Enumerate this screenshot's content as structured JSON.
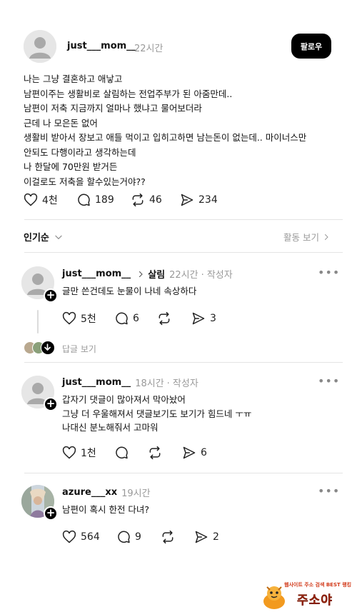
{
  "post": {
    "username": "just___mom__",
    "time": "22시간",
    "follow_label": "팔로우",
    "body": "나는 그냥 결혼하고 애낳고\n남편이주는 생활비로 살림하는 전업주부가 된 아줌만데..\n남편이 저축 지금까지 얼마나 했냐고 물어보더라\n근데 나 모은돈 없어\n생활비 받아서 장보고 애들 먹이고 입히고하면 남는돈이 없는데.. 마이너스만\n안되도 다행이라고 생각하는데\n나 한달에 70만원 받거든\n이걸로도 저축을 할수있는거야??",
    "likes": "4천",
    "comments": "189",
    "reposts": "46",
    "shares": "234"
  },
  "sort": {
    "label": "인기순",
    "activity_label": "활동 보기"
  },
  "replies": [
    {
      "username": "just___mom__",
      "tag": "살림",
      "time": "22시간",
      "author_badge": "· 작성자",
      "text": "글만 쓴건데도 눈물이 나네 속상하다",
      "likes": "5천",
      "comments": "6",
      "shares": "3",
      "view_replies": "답글 보기"
    },
    {
      "username": "just___mom__",
      "time": "18시간",
      "author_badge": "· 작성자",
      "text": "갑자기 댓글이 많아져서 막아놨어\n그냥 더 우울해져서 댓글보기도 보기가 힘드네 ㅜㅠ\n나대신 분노해줘서 고마워",
      "likes": "1천",
      "shares": "6"
    },
    {
      "username": "azure___xx",
      "time": "19시간",
      "text": "남편이 혹시 한전 다녀?",
      "likes": "564",
      "comments": "9",
      "shares": "2"
    }
  ],
  "watermark": {
    "tagline": "웹사이트 주소 검색 BEST 랭킹",
    "brand": "주소야"
  },
  "colors": {
    "accent": "#000000",
    "muted": "#999999",
    "divider": "#e4e4e4"
  }
}
